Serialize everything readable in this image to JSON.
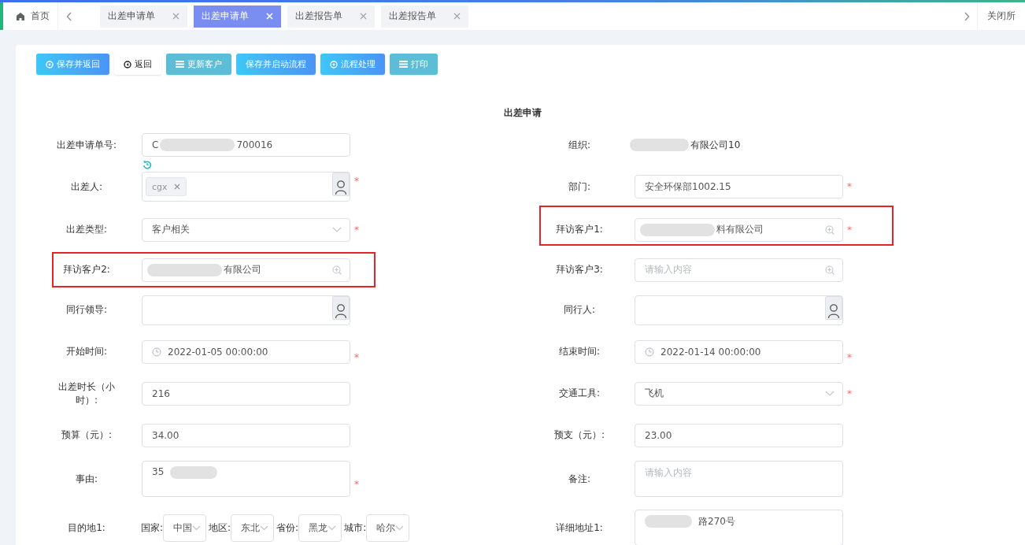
{
  "tabbar": {
    "home": "首页",
    "close_all": "关闭所",
    "tabs": [
      {
        "label": "出差申请单",
        "selected": false
      },
      {
        "label": "出差申请单",
        "selected": true
      },
      {
        "label": "出差报告单",
        "selected": false
      },
      {
        "label": "出差报告单",
        "selected": false
      }
    ]
  },
  "toolbar": [
    {
      "label": "保存并返回",
      "kind": "save"
    },
    {
      "label": "返回",
      "kind": "back"
    },
    {
      "label": "更新客户",
      "kind": "update"
    },
    {
      "label": "保存并启动流程",
      "kind": "start"
    },
    {
      "label": "流程处理",
      "kind": "process"
    },
    {
      "label": "打印",
      "kind": "print"
    }
  ],
  "form": {
    "title": "出差申请",
    "rows": [
      {
        "left": {
          "label": "出差申请单号:",
          "kind": "text",
          "segments": [
            {
              "kind": "text",
              "text": "C"
            },
            {
              "kind": "blur"
            },
            {
              "kind": "text",
              "text": "700016"
            }
          ],
          "reset": true
        },
        "right": {
          "label": "组织:",
          "kind": "static",
          "segments": [
            {
              "kind": "blur"
            },
            {
              "kind": "text",
              "text": "有限公司10"
            }
          ]
        }
      },
      {
        "left": {
          "label": "出差人:",
          "kind": "person",
          "tags": [
            "cgx"
          ],
          "required_mark": "*"
        },
        "right": {
          "label": "部门:",
          "kind": "text",
          "segments": [
            {
              "kind": "text",
              "text": "安全环保部1002.15"
            }
          ],
          "required_mark": "*"
        }
      },
      {
        "left": {
          "label": "出差类型:",
          "kind": "select",
          "segments": [
            {
              "kind": "text",
              "text": "客户相关"
            }
          ],
          "required_mark": "*"
        },
        "right": {
          "label": "拜访客户1:",
          "kind": "search",
          "segments": [
            {
              "kind": "blur"
            },
            {
              "kind": "text",
              "text": "料有限公司"
            }
          ],
          "required_mark": "*",
          "highlighted": true
        }
      },
      {
        "left": {
          "label": "拜访客户2:",
          "kind": "search",
          "segments": [
            {
              "kind": "blur"
            },
            {
              "kind": "text",
              "text": "有限公司"
            }
          ],
          "highlighted": true
        },
        "right": {
          "label": "拜访客户3:",
          "kind": "search",
          "placeholder": "请输入内容"
        }
      },
      {
        "left": {
          "label": "同行领导:",
          "kind": "person"
        },
        "right": {
          "label": "同行人:",
          "kind": "person"
        }
      },
      {
        "left": {
          "label": "开始时间:",
          "kind": "date",
          "segments": [
            {
              "kind": "text",
              "text": "2022-01-05 00:00:00"
            }
          ],
          "required_mark": "*"
        },
        "right": {
          "label": "结束时间:",
          "kind": "date",
          "segments": [
            {
              "kind": "text",
              "text": "2022-01-14 00:00:00"
            }
          ],
          "required_mark": "*"
        }
      },
      {
        "left": {
          "label": "出差时长（小时）:",
          "kind": "text",
          "segments": [
            {
              "kind": "text",
              "text": "216"
            }
          ]
        },
        "right": {
          "label": "交通工具:",
          "kind": "select",
          "segments": [
            {
              "kind": "text",
              "text": "飞机"
            }
          ],
          "required_mark": "*"
        }
      },
      {
        "left": {
          "label": "预算（元）:",
          "kind": "text",
          "segments": [
            {
              "kind": "text",
              "text": "34.00"
            }
          ]
        },
        "right": {
          "label": "预支（元）:",
          "kind": "text",
          "segments": [
            {
              "kind": "text",
              "text": "23.00"
            }
          ]
        }
      },
      {
        "left": {
          "label": "事由:",
          "kind": "textarea",
          "segments": [
            {
              "kind": "text",
              "text": "35"
            },
            {
              "kind": "blur"
            }
          ],
          "required_mark": "*"
        },
        "right": {
          "label": "备注:",
          "kind": "textarea",
          "placeholder": "请输入内容"
        }
      },
      {
        "left": {
          "label": "目的地1:",
          "kind": "destination",
          "parts": [
            {
              "label": "国家:",
              "value": "中国"
            },
            {
              "label": "地区:",
              "value": "东北"
            },
            {
              "label": "省份:",
              "value": "黑龙"
            },
            {
              "label": "城市:",
              "value": "哈尔"
            }
          ]
        },
        "right": {
          "label": "详细地址1:",
          "kind": "textarea",
          "segments": [
            {
              "kind": "blur"
            },
            {
              "kind": "text",
              "text": "路270号"
            }
          ]
        }
      }
    ]
  }
}
